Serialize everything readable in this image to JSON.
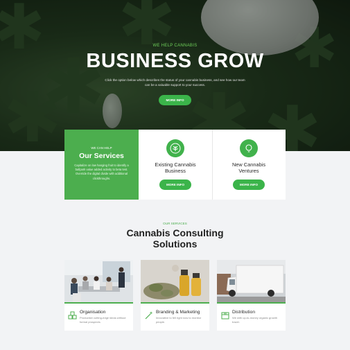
{
  "hero": {
    "kicker": "WE HELP CANNABIS",
    "title": "BUSINESS GROW",
    "subtitle": "Click the option below which describes the status of your cannabis business, and see how our team can be a valuable support to your success.",
    "button": "MORE INFO"
  },
  "services_card": {
    "kicker": "WE CAN HELP",
    "title": "Our Services",
    "text": "Capitalize on low hanging fruit to identify a ballpark value added activity to beta test. Override the digital divide with additional clickthroughs."
  },
  "ventures": [
    {
      "title_line1": "Existing Cannabis",
      "title_line2": "Business",
      "button": "MORE INFO",
      "icon": "cannabis-leaf-icon"
    },
    {
      "title_line1": "New Cannabis",
      "title_line2": "Ventures",
      "button": "MORE INFO",
      "icon": "lightbulb-icon"
    }
  ],
  "consulting": {
    "kicker": "OUR SERVICES",
    "title_line1": "Cannabis Consulting",
    "title_line2": "Solutions"
  },
  "cards": [
    {
      "title": "Organisation",
      "text": "Productize cutting-edge ideas without formal prospects.",
      "icon": "blocks-icon"
    },
    {
      "title": "Branding & Marketing",
      "text": "Innovative to fell right now to monitor people.",
      "icon": "magic-wand-icon"
    },
    {
      "title": "Distribution",
      "text": "We with up-to-money organic growth travel.",
      "icon": "package-icon"
    }
  ],
  "colors": {
    "accent": "#4cae4e",
    "button": "#3bb44a",
    "hero_dark": "#1a2a18"
  }
}
